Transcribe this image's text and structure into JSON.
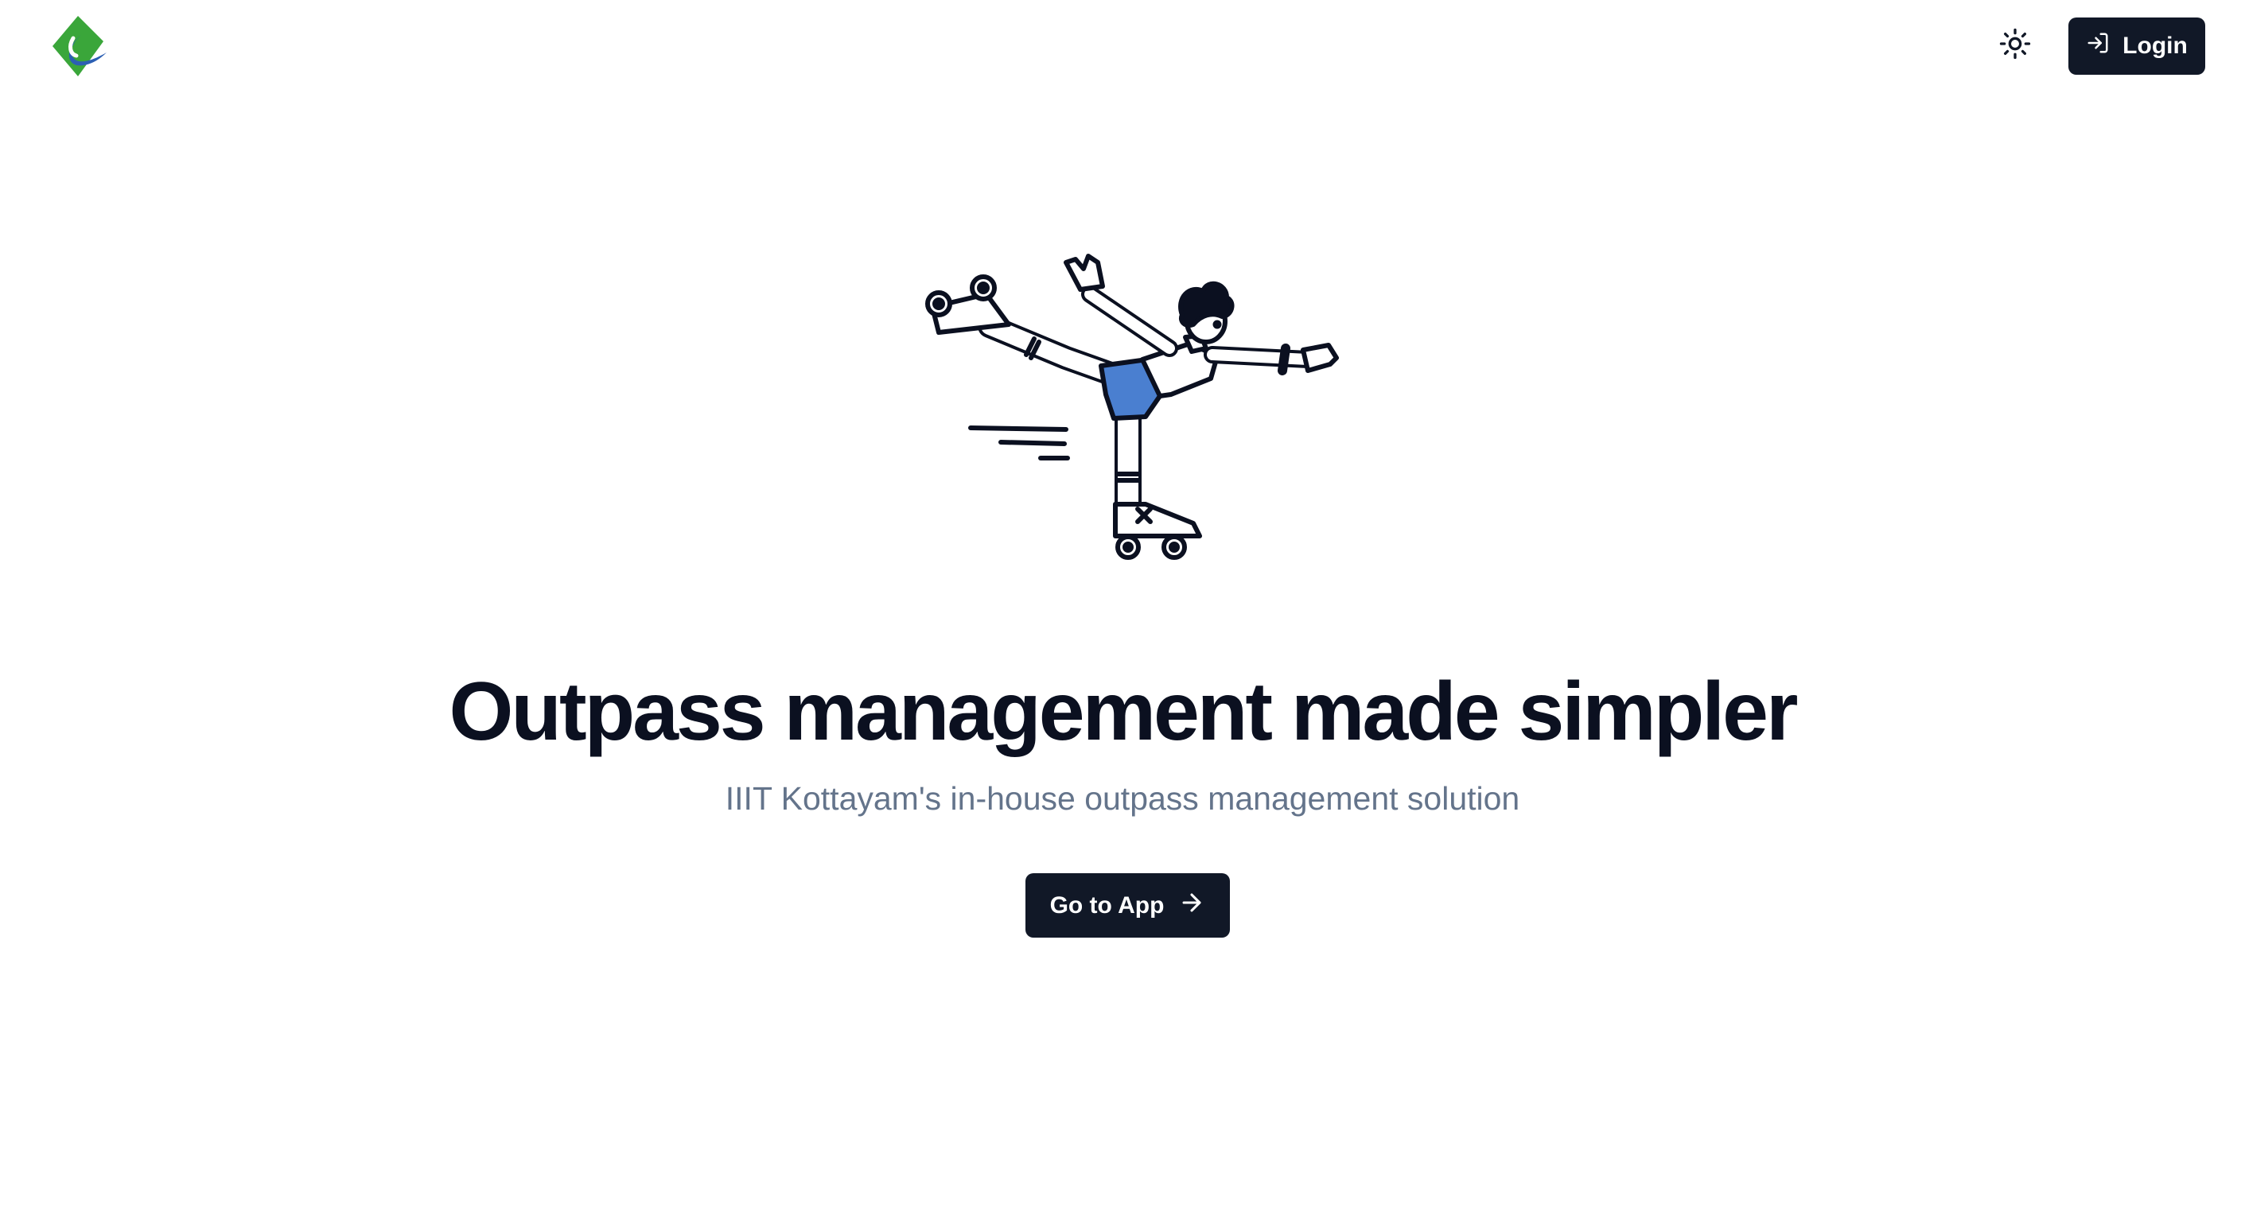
{
  "header": {
    "logo_icon": "iiit-kottayam-logo",
    "theme_toggle_icon": "sun-icon",
    "login": {
      "label": "Login",
      "icon": "login-icon"
    }
  },
  "hero": {
    "illustration": "roller-skater-illustration",
    "title": "Outpass management made simpler",
    "subtitle": "IIIT Kottayam's in-house outpass management solution",
    "cta": {
      "label": "Go to App",
      "icon": "arrow-right-icon"
    }
  },
  "colors": {
    "primary": "#111827",
    "title": "#0b1020",
    "subtitle": "#64748b",
    "logo_green": "#3aa63a",
    "logo_blue": "#2c5fb3",
    "shorts_blue": "#4a7fd0"
  }
}
